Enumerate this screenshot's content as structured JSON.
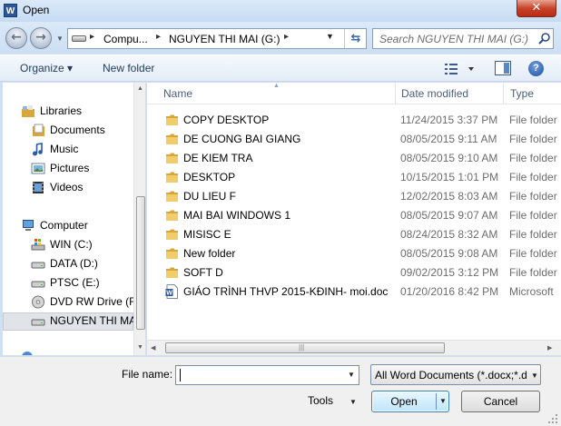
{
  "window": {
    "app_icon_letter": "W",
    "title": "Open"
  },
  "address": {
    "breadcrumbs": [
      "Compu...",
      "NGUYEN THI  MAI (G:)"
    ],
    "search_placeholder": "Search NGUYEN THI  MAI (G:)"
  },
  "toolbar": {
    "organize_label": "Organize ▾",
    "new_folder_label": "New folder"
  },
  "navigation": {
    "libraries_label": "Libraries",
    "libraries": [
      "Documents",
      "Music",
      "Pictures",
      "Videos"
    ],
    "computer_label": "Computer",
    "drives": [
      "WIN (C:)",
      "DATA (D:)",
      "PTSC (E:)",
      "DVD RW Drive (F:",
      "NGUYEN THI  MA"
    ]
  },
  "filelist": {
    "columns": [
      "Name",
      "Date modified",
      "Type"
    ],
    "rows": [
      {
        "name": "COPY DESKTOP",
        "date": "11/24/2015 3:37 PM",
        "type": "File folder",
        "kind": "folder"
      },
      {
        "name": "DE CUONG BAI GIANG",
        "date": "08/05/2015 9:11 AM",
        "type": "File folder",
        "kind": "folder"
      },
      {
        "name": "DE KIEM TRA",
        "date": "08/05/2015 9:10 AM",
        "type": "File folder",
        "kind": "folder"
      },
      {
        "name": "DESKTOP",
        "date": "10/15/2015 1:01 PM",
        "type": "File folder",
        "kind": "folder"
      },
      {
        "name": "DU LIEU F",
        "date": "12/02/2015 8:03 AM",
        "type": "File folder",
        "kind": "folder"
      },
      {
        "name": "MAI BAI WINDOWS 1",
        "date": "08/05/2015 9:07 AM",
        "type": "File folder",
        "kind": "folder"
      },
      {
        "name": "MISISC E",
        "date": "08/24/2015 8:32 AM",
        "type": "File folder",
        "kind": "folder"
      },
      {
        "name": "New folder",
        "date": "08/05/2015 9:08 AM",
        "type": "File folder",
        "kind": "folder"
      },
      {
        "name": "SOFT D",
        "date": "09/02/2015 3:12 PM",
        "type": "File folder",
        "kind": "folder"
      },
      {
        "name": "GIÁO TRÌNH THVP 2015-KĐINH- moi.doc",
        "date": "01/20/2016 8:42 PM",
        "type": "Microsoft",
        "kind": "doc"
      }
    ]
  },
  "bottom": {
    "filename_label": "File name:",
    "filename_value": "",
    "filetype_selected": "All Word Documents (*.docx;*.d",
    "tools_label": "Tools",
    "open_label": "Open",
    "cancel_label": "Cancel"
  },
  "colors": {
    "folder": "#e8c462",
    "accent": "#3c7fb1",
    "close": "#c7432a"
  }
}
